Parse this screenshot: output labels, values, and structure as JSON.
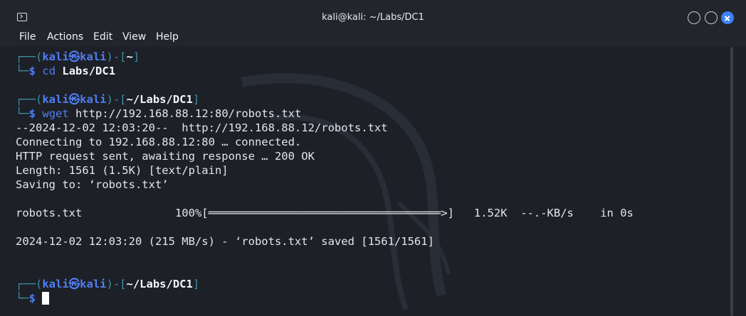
{
  "window": {
    "title": "kali@kali: ~/Labs/DC1"
  },
  "menubar": {
    "items": [
      "File",
      "Actions",
      "Edit",
      "View",
      "Help"
    ]
  },
  "prompt": {
    "corner_top": "┌──(",
    "user": "kali",
    "at_glyph": "㉿",
    "host": "kali",
    "sep": ")-[",
    "close": "]",
    "corner_bottom": "└─",
    "dollar": "$"
  },
  "session": {
    "p1_dir": "~",
    "cmd1_name": "cd",
    "cmd1_arg": "Labs/DC1",
    "p2_dir": "~/Labs/DC1",
    "cmd2_name": "wget",
    "cmd2_arg": "http://192.168.88.12:80/robots.txt",
    "out1": "--2024-12-02 12:03:20--  http://192.168.88.12/robots.txt",
    "out2": "Connecting to 192.168.88.12:80 … connected.",
    "out3": "HTTP request sent, awaiting response … 200 OK",
    "out4": "Length: 1561 (1.5K) [text/plain]",
    "out5": "Saving to: ‘robots.txt’",
    "progress_line": "robots.txt              100%[═══════════════════════════════════>]   1.52K  --.-KB/s    in 0s",
    "saved_line": "2024-12-02 12:03:20 (215 MB/s) - ‘robots.txt’ saved [1561/1561]",
    "p3_dir": "~/Labs/DC1"
  },
  "colors": {
    "prompt_blue": "#4f7ff2",
    "prompt_teal": "#3f8fa6",
    "background": "#1d2027",
    "close_button": "#3b82f6"
  }
}
